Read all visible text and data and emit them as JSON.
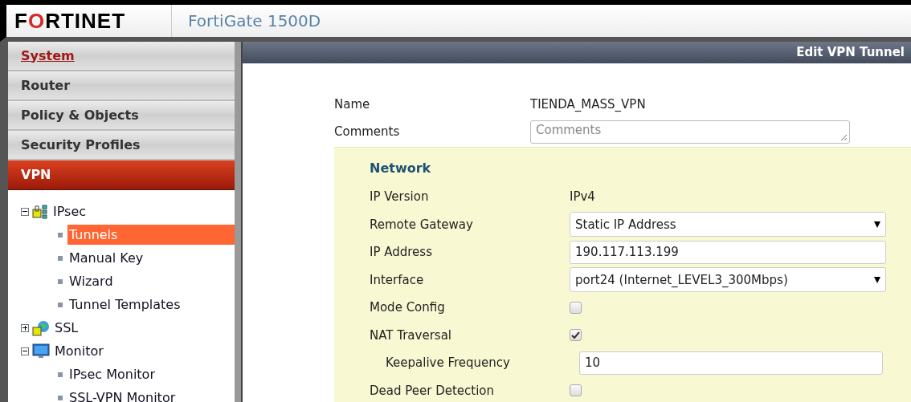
{
  "header": {
    "logo": "FORTINET",
    "product": "FortiGate 1500D"
  },
  "sidebar": {
    "sections": [
      {
        "label": "System",
        "selected": false,
        "link": true
      },
      {
        "label": "Router",
        "selected": false,
        "link": false
      },
      {
        "label": "Policy & Objects",
        "selected": false,
        "link": false
      },
      {
        "label": "Security Profiles",
        "selected": false,
        "link": false
      },
      {
        "label": "VPN",
        "selected": true,
        "link": false
      }
    ],
    "tree": [
      {
        "label": "IPsec",
        "kind": "ipsec",
        "expanded": true,
        "children": [
          {
            "label": "Tunnels",
            "selected": true
          },
          {
            "label": "Manual Key",
            "selected": false
          },
          {
            "label": "Wizard",
            "selected": false
          },
          {
            "label": "Tunnel Templates",
            "selected": false
          }
        ]
      },
      {
        "label": "SSL",
        "kind": "ssl",
        "expanded": false
      },
      {
        "label": "Monitor",
        "kind": "monitor",
        "expanded": true,
        "children": [
          {
            "label": "IPsec Monitor",
            "selected": false
          },
          {
            "label": "SSL-VPN Monitor",
            "selected": false
          }
        ]
      }
    ]
  },
  "panel": {
    "title": "Edit VPN Tunnel",
    "top_fields": [
      {
        "kind": "text",
        "label": "Name",
        "value": "TIENDA_MASS_VPN"
      },
      {
        "kind": "textarea",
        "label": "Comments",
        "placeholder": "Comments"
      }
    ],
    "section": {
      "title": "Network",
      "fields": [
        {
          "kind": "text",
          "label": "IP Version",
          "value": "IPv4"
        },
        {
          "kind": "select",
          "label": "Remote Gateway",
          "value": "Static IP Address"
        },
        {
          "kind": "input",
          "label": "IP Address",
          "value": "190.117.113.199"
        },
        {
          "kind": "select",
          "label": "Interface",
          "value": "port24 (Internet_LEVEL3_300Mbps)"
        },
        {
          "kind": "checkbox",
          "label": "Mode Config",
          "checked": false
        },
        {
          "kind": "checkbox",
          "label": "NAT Traversal",
          "checked": true,
          "children": [
            {
              "kind": "input",
              "label": "Keepalive Frequency",
              "value": "10"
            }
          ]
        },
        {
          "kind": "checkbox",
          "label": "Dead Peer Detection",
          "checked": false
        }
      ]
    }
  }
}
